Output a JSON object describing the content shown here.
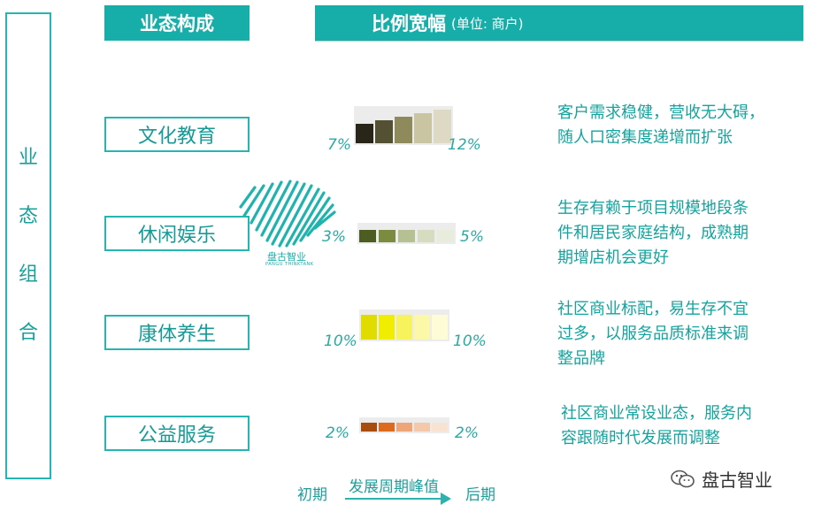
{
  "side_label": [
    "业",
    "态",
    "组",
    "合"
  ],
  "header": {
    "col1": "业态构成",
    "col2": "比例宽幅",
    "unit": "(单位: 商户)"
  },
  "rows": [
    {
      "category": "文化教育",
      "pct_low": "7%",
      "pct_high": "12%",
      "swatches": [
        "#2a2519",
        "#545034",
        "#8f8a5c",
        "#c9c5a3",
        "#ddd9c4"
      ],
      "desc": [
        "客户需求稳健，营收无大碍，",
        "随人口密集度递增而扩张"
      ]
    },
    {
      "category": "休闲娱乐",
      "pct_low": "3%",
      "pct_high": "5%",
      "swatches": [
        "#4d5c20",
        "#7b8b3f",
        "#b5c192",
        "#d5dcbf",
        "#e8ecdc"
      ],
      "desc": [
        "生存有赖于项目规模地段条",
        "件和居民家庭结构，成熟期",
        "期增店机会更好"
      ]
    },
    {
      "category": "康体养生",
      "pct_low": "10%",
      "pct_high": "10%",
      "swatches": [
        "#e1dc00",
        "#f1ed00",
        "#f7f35c",
        "#fbf9a8",
        "#fdfcd6"
      ],
      "desc": [
        "社区商业标配，易生存不宜",
        "过多，以服务品质标准来调",
        "整品牌"
      ]
    },
    {
      "category": "公益服务",
      "pct_low": "2%",
      "pct_high": "2%",
      "swatches": [
        "#a84d10",
        "#dc6a1f",
        "#eea679",
        "#f4c8ab",
        "#f8e2d2"
      ],
      "desc": [
        "社区商业常设业态，服务内",
        "容跟随时代发展而调整"
      ]
    }
  ],
  "footer": {
    "early": "初期",
    "peak": "发展周期峰值",
    "late": "后期"
  },
  "logo": {
    "name": "盘古智业",
    "sub": "PANGU THINKTANK"
  },
  "watermark": "盘古智业",
  "colors": {
    "accent": "#17aeaa",
    "border": "#26b5b0"
  }
}
